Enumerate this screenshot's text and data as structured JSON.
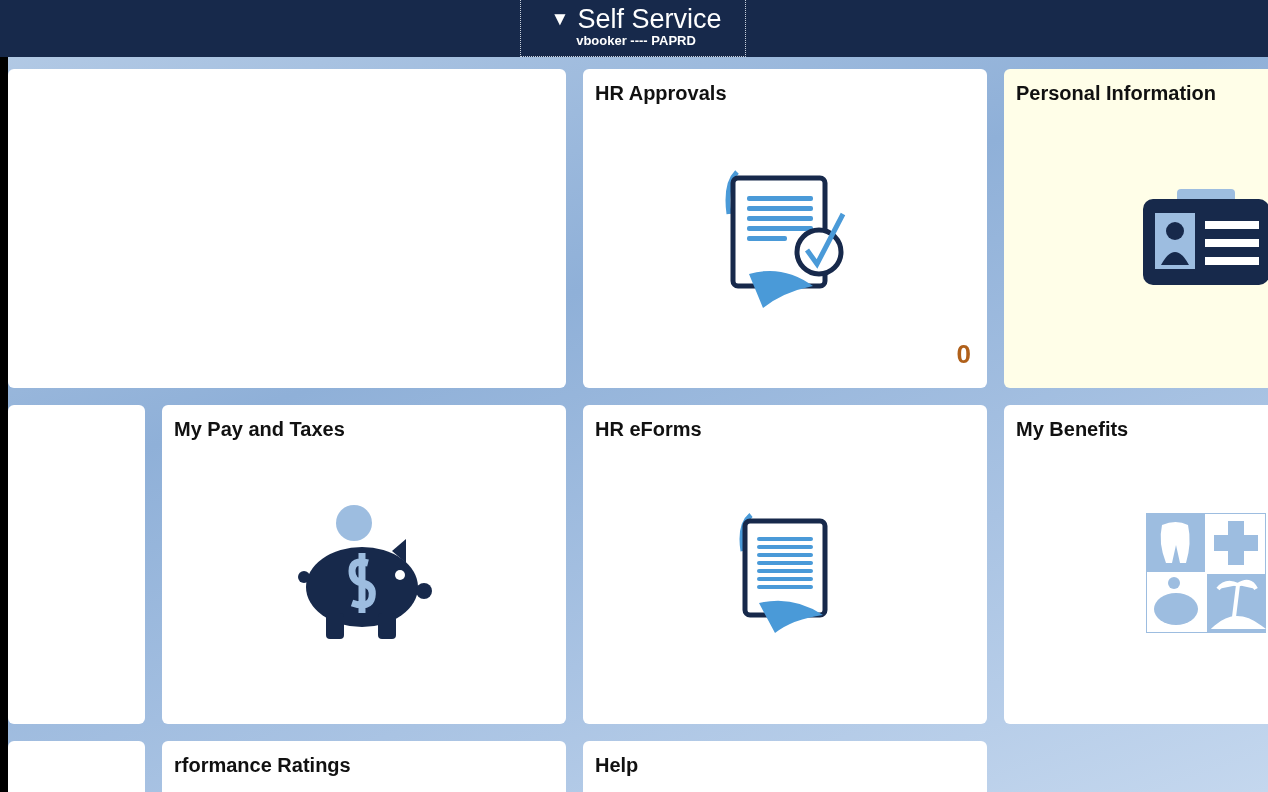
{
  "header": {
    "caret": "▼",
    "title": "Self Service",
    "subtitle": "vbooker ---- PAPRD"
  },
  "tiles": [
    {
      "kind": "wide-blank",
      "highlighted": false
    },
    {
      "kind": "approvals",
      "title": "HR Approvals",
      "badge": "0",
      "highlighted": false
    },
    {
      "kind": "id-card",
      "title": "Personal Information",
      "highlighted": true
    },
    {
      "kind": "blank",
      "highlighted": false
    },
    {
      "kind": "piggy",
      "title": "My Pay and Taxes",
      "highlighted": false
    },
    {
      "kind": "eform",
      "title": "HR eForms",
      "highlighted": false
    },
    {
      "kind": "benefits",
      "title": "My Benefits",
      "highlighted": false
    },
    {
      "kind": "blank",
      "highlighted": false
    },
    {
      "kind": "plain",
      "title": "rformance Ratings",
      "highlighted": false
    },
    {
      "kind": "plain",
      "title": "Help",
      "highlighted": false
    }
  ]
}
